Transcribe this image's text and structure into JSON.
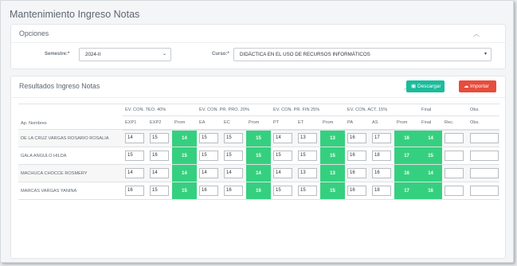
{
  "page": {
    "title": "Mantenimiento Ingreso Notas"
  },
  "opciones": {
    "title": "Opciones",
    "semestre_label": "Semestre:*",
    "semestre_value": "2024-II",
    "curso_label": "Curso:*",
    "curso_value": "DIDÁCTICA EN EL USO DE RECURSOS INFORMÁTICOS"
  },
  "resultados": {
    "title": "Resultados Ingreso Notas",
    "descargar_label": "Descargar",
    "importar_label": "Importar"
  },
  "colors": {
    "accent_green": "#1abc9c",
    "accent_red": "#e74c3c",
    "prom_green": "#35d07f"
  },
  "table": {
    "group_headers": [
      "EV. CON. TEO. 40%",
      "EV. CON. PR. PRO. 20%",
      "EV. CON. PR. FIN 25%",
      "EV. CON. ACT. 15%",
      "Final",
      "Obs."
    ],
    "name_header": "Ap. Nombres",
    "sub_headers": [
      "EXP1",
      "EXP2",
      "Prom",
      "EA",
      "EC",
      "Prom",
      "PT",
      "ET",
      "Prom",
      "PA",
      "AS",
      "Prom",
      "Final",
      "Rec.",
      "Obs."
    ],
    "rows": [
      {
        "name": "DE LA CRUZ VARGAS ROSARIO ROSALIA",
        "exp1": "14",
        "exp2": "15",
        "prom1": "14",
        "ea": "15",
        "ec": "15",
        "prom2": "15",
        "pt": "14",
        "et": "13",
        "prom3": "13",
        "pa": "16",
        "as": "17",
        "prom4": "16",
        "final": "14"
      },
      {
        "name": "GALA ANGULO HILDA",
        "exp1": "15",
        "exp2": "16",
        "prom1": "15",
        "ea": "15",
        "ec": "15",
        "prom2": "15",
        "pt": "15",
        "et": "15",
        "prom3": "15",
        "pa": "16",
        "as": "18",
        "prom4": "17",
        "final": "15"
      },
      {
        "name": "MACHUCA CHOCCE ROSMERY",
        "exp1": "14",
        "exp2": "14",
        "prom1": "14",
        "ea": "14",
        "ec": "14",
        "prom2": "14",
        "pt": "14",
        "et": "13",
        "prom3": "13",
        "pa": "16",
        "as": "16",
        "prom4": "16",
        "final": "14"
      },
      {
        "name": "MARCAS VARGAS YANINA",
        "exp1": "16",
        "exp2": "15",
        "prom1": "15",
        "ea": "16",
        "ec": "16",
        "prom2": "16",
        "pt": "15",
        "et": "15",
        "prom3": "15",
        "pa": "16",
        "as": "18",
        "prom4": "17",
        "final": "16"
      }
    ]
  }
}
